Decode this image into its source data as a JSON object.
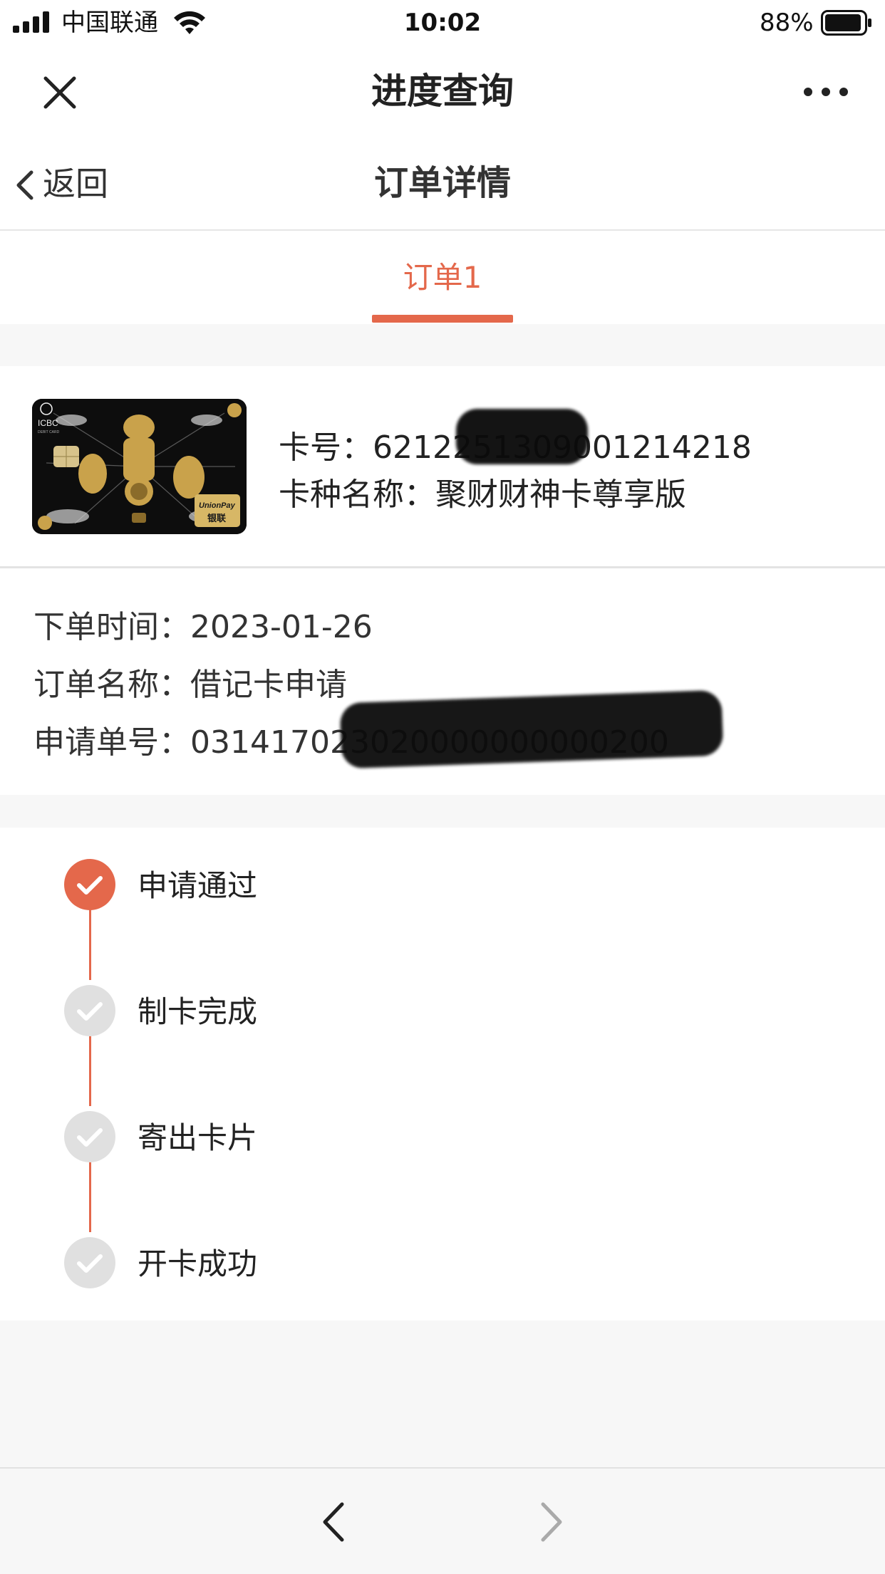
{
  "status_bar": {
    "carrier": "中国联通",
    "time": "10:02",
    "battery": "88%"
  },
  "header": {
    "title": "进度查询"
  },
  "sub_header": {
    "back_label": "返回",
    "title": "订单详情"
  },
  "tabs": [
    {
      "label": "订单1",
      "active": true
    }
  ],
  "card": {
    "number_label": "卡号：",
    "number_value": "6212251309001214218",
    "type_label": "卡种名称：",
    "type_value": "聚财财神卡尊享版",
    "image_text": {
      "bank_name": "ICBC",
      "card_type": "DEBIT CARD",
      "network": "UnionPay",
      "network_cn": "银联"
    }
  },
  "order_info": {
    "time_label": "下单时间：",
    "time_value": "2023-01-26",
    "name_label": "订单名称：",
    "name_value": "借记卡申请",
    "apply_no_label": "申请单号：",
    "apply_no_value": "031417023020000000000200"
  },
  "progress": {
    "steps": [
      {
        "label": "申请通过",
        "done": true
      },
      {
        "label": "制卡完成",
        "done": false
      },
      {
        "label": "寄出卡片",
        "done": false
      },
      {
        "label": "开卡成功",
        "done": false
      }
    ]
  },
  "colors": {
    "accent": "#e4684b",
    "inactive": "#e0e0e0",
    "page_bg": "#f7f7f7"
  },
  "icons": {
    "close": "close-icon",
    "more": "more-icon",
    "back": "chevron-left-icon",
    "check": "check-icon",
    "nav_back": "nav-back-icon",
    "nav_forward": "nav-forward-icon"
  }
}
